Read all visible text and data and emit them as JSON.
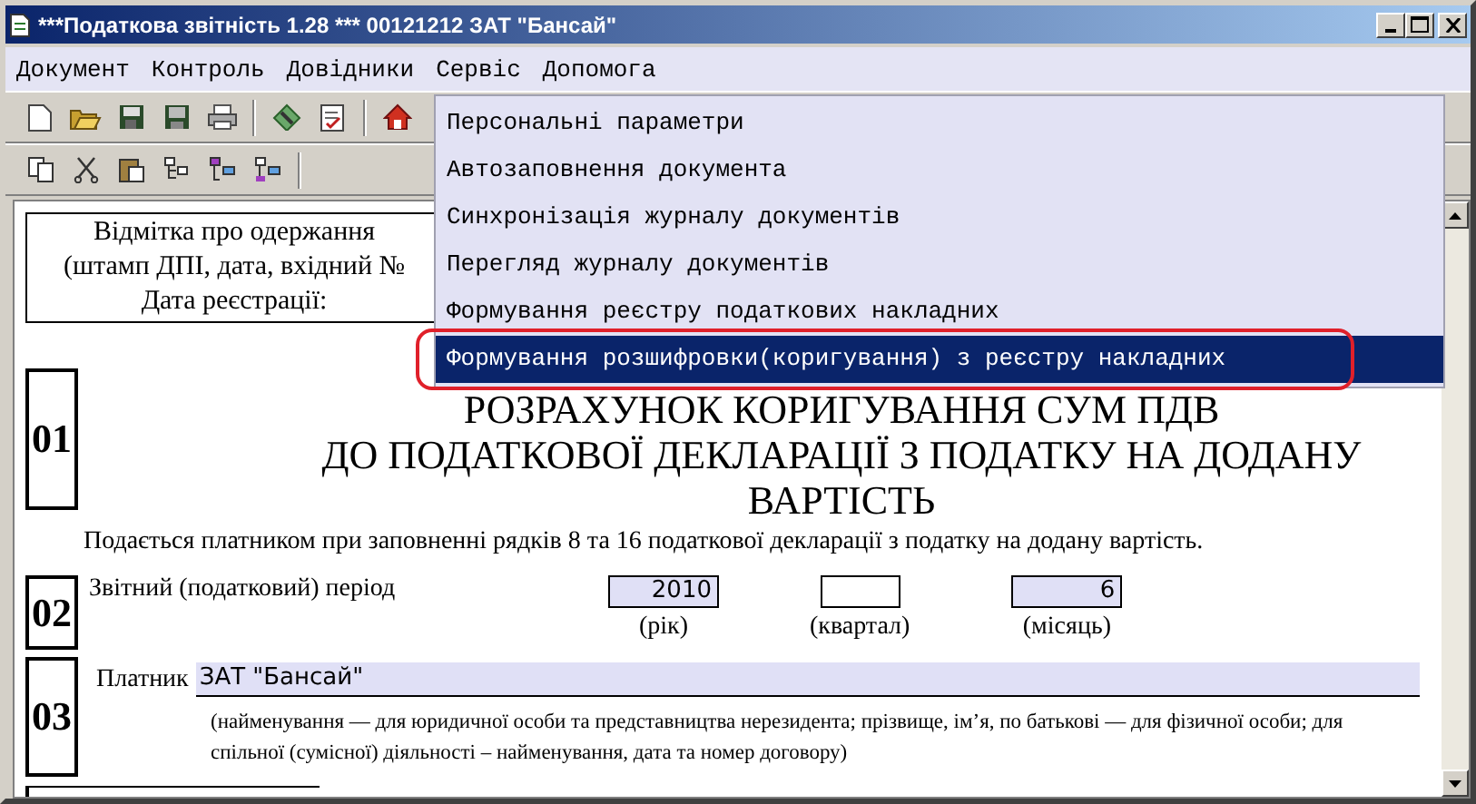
{
  "window": {
    "title": "***Податкова звітність 1.28 *** 00121212 ЗАТ \"Бансай\""
  },
  "menubar": [
    {
      "label": "Документ"
    },
    {
      "label": "Контроль"
    },
    {
      "label": "Довідники"
    },
    {
      "label": "Сервіс"
    },
    {
      "label": "Допомога"
    }
  ],
  "dropdown": {
    "items": [
      {
        "label": "Персональні параметри",
        "selected": false
      },
      {
        "label": "Автозаповнення документа",
        "selected": false
      },
      {
        "label": "Синхронізація журналу документів",
        "selected": false
      },
      {
        "label": "Перегляд журналу документів",
        "selected": false
      },
      {
        "label": "Формування реєстру податкових накладних",
        "selected": false
      },
      {
        "label": "Формування розшифровки(коригування) з реєстру накладних",
        "selected": true
      }
    ]
  },
  "document": {
    "stamp": [
      "Відмітка про одержання",
      "(штамп ДПІ, дата, вхідний №",
      "Дата реєстрації:"
    ],
    "section_01": {
      "number": "01",
      "title": [
        "РОЗРАХУНОК КОРИГУВАННЯ СУМ ПДВ",
        "ДО ПОДАТКОВОЇ ДЕКЛАРАЦІЇ З ПОДАТКУ НА ДОДАНУ",
        "ВАРТІСТЬ"
      ]
    },
    "note": "Подається платником при заповненні рядків 8 та 16 податкової декларації з податку на додану вартість.",
    "section_02": {
      "number": "02",
      "label": "Звітний (податковий) період",
      "fields": [
        {
          "value": "2010",
          "caption": "(рік)",
          "filled": true
        },
        {
          "caption": "(квартал)",
          "filled": false
        },
        {
          "value": "6",
          "caption": "(місяць)",
          "filled": true
        }
      ]
    },
    "section_03": {
      "number": "03",
      "label": "Платник",
      "value": "ЗАТ \"Бансай\"",
      "caption": "(найменування — для юридичної особи та представництва нерезидента; прізвище, ім’я, по батькові — для фізичної особи; для спільної (сумісної) діяльності – найменування, дата та номер договору)"
    }
  }
}
